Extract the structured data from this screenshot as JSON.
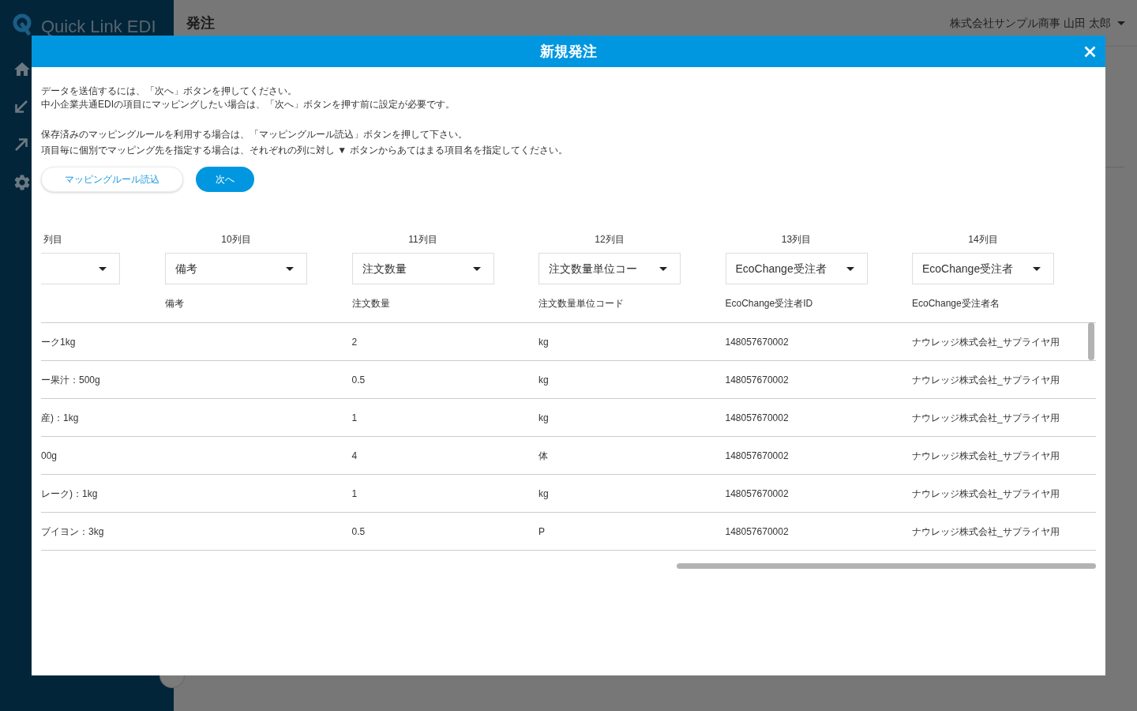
{
  "sidebar": {
    "logo": "Quick Link EDI"
  },
  "header": {
    "title": "発注",
    "user_menu": "株式会社サンプル商事 山田 太郎"
  },
  "dialog": {
    "title": "新規発注",
    "paragraphs": [
      [
        "データを送信するには、「次へ」ボタンを押してください。",
        "中小企業共通EDIの項目にマッピングしたい場合は、「次へ」ボタンを押す前に設定が必要です。"
      ],
      [
        "保存済みのマッピングルールを利用する場合は、「マッピングルール読込」ボタンを押して下さい。",
        "項目毎に個別でマッピング先を指定する場合は、それぞれの列に対し ▼ ボタンからあてはまる項目名を指定してください。"
      ]
    ],
    "buttons": [
      {
        "label": "マッピングルール読込",
        "kind": "secondary"
      },
      {
        "label": "次へ",
        "kind": "primary"
      }
    ],
    "table": {
      "columns": [
        {
          "header": "列目"
        },
        {
          "header": "10列目",
          "mapping": "備考",
          "field": "備考"
        },
        {
          "header": "11列目",
          "mapping": "注文数量",
          "field": "注文数量"
        },
        {
          "header": "12列目",
          "mapping": "注文数量単位コー",
          "field": "注文数量単位コード"
        },
        {
          "header": "13列目",
          "mapping": "EcoChange受注者",
          "field": "EcoChange受注者ID"
        },
        {
          "header": "14列目",
          "mapping": "EcoChange受注者",
          "field": "EcoChange受注者名"
        }
      ],
      "rows": [
        [
          "ーク1kg",
          null,
          "2",
          "kg",
          "148057670002",
          "ナウレッジ株式会社_サプライヤ用"
        ],
        [
          "ー果汁：500g",
          null,
          "0.5",
          "kg",
          "148057670002",
          "ナウレッジ株式会社_サプライヤ用"
        ],
        [
          "産)：1kg",
          null,
          "1",
          "kg",
          "148057670002",
          "ナウレッジ株式会社_サプライヤ用"
        ],
        [
          "00g",
          null,
          "4",
          "体",
          "148057670002",
          "ナウレッジ株式会社_サプライヤ用"
        ],
        [
          "レーク)：1kg",
          null,
          "1",
          "kg",
          "148057670002",
          "ナウレッジ株式会社_サプライヤ用"
        ],
        [
          "ブイヨン：3kg",
          null,
          "0.5",
          "P",
          "148057670002",
          "ナウレッジ株式会社_サプライヤ用"
        ]
      ]
    }
  }
}
